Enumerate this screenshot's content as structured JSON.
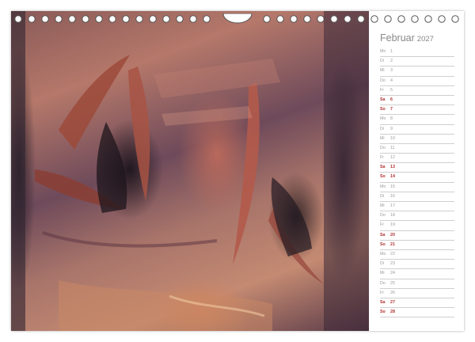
{
  "calendar": {
    "month": "Februar",
    "year": "2027",
    "days": [
      {
        "wd": "Mo",
        "n": "1",
        "weekend": false
      },
      {
        "wd": "Di",
        "n": "2",
        "weekend": false
      },
      {
        "wd": "Mi",
        "n": "3",
        "weekend": false
      },
      {
        "wd": "Do",
        "n": "4",
        "weekend": false
      },
      {
        "wd": "Fr",
        "n": "5",
        "weekend": false
      },
      {
        "wd": "Sa",
        "n": "6",
        "weekend": true
      },
      {
        "wd": "So",
        "n": "7",
        "weekend": true
      },
      {
        "wd": "Mo",
        "n": "8",
        "weekend": false
      },
      {
        "wd": "Di",
        "n": "9",
        "weekend": false
      },
      {
        "wd": "Mi",
        "n": "10",
        "weekend": false
      },
      {
        "wd": "Do",
        "n": "11",
        "weekend": false
      },
      {
        "wd": "Fr",
        "n": "12",
        "weekend": false
      },
      {
        "wd": "Sa",
        "n": "13",
        "weekend": true
      },
      {
        "wd": "So",
        "n": "14",
        "weekend": true
      },
      {
        "wd": "Mo",
        "n": "15",
        "weekend": false
      },
      {
        "wd": "Di",
        "n": "16",
        "weekend": false
      },
      {
        "wd": "Mi",
        "n": "17",
        "weekend": false
      },
      {
        "wd": "Do",
        "n": "18",
        "weekend": false
      },
      {
        "wd": "Fr",
        "n": "19",
        "weekend": false
      },
      {
        "wd": "Sa",
        "n": "20",
        "weekend": true
      },
      {
        "wd": "So",
        "n": "21",
        "weekend": true
      },
      {
        "wd": "Mo",
        "n": "22",
        "weekend": false
      },
      {
        "wd": "Di",
        "n": "23",
        "weekend": false
      },
      {
        "wd": "Mi",
        "n": "24",
        "weekend": false
      },
      {
        "wd": "Do",
        "n": "25",
        "weekend": false
      },
      {
        "wd": "Fr",
        "n": "26",
        "weekend": false
      },
      {
        "wd": "Sa",
        "n": "27",
        "weekend": true
      },
      {
        "wd": "So",
        "n": "28",
        "weekend": true
      }
    ]
  },
  "colors": {
    "weekend": "#b03030",
    "weekday": "#9a9a9a",
    "month": "#888888"
  }
}
